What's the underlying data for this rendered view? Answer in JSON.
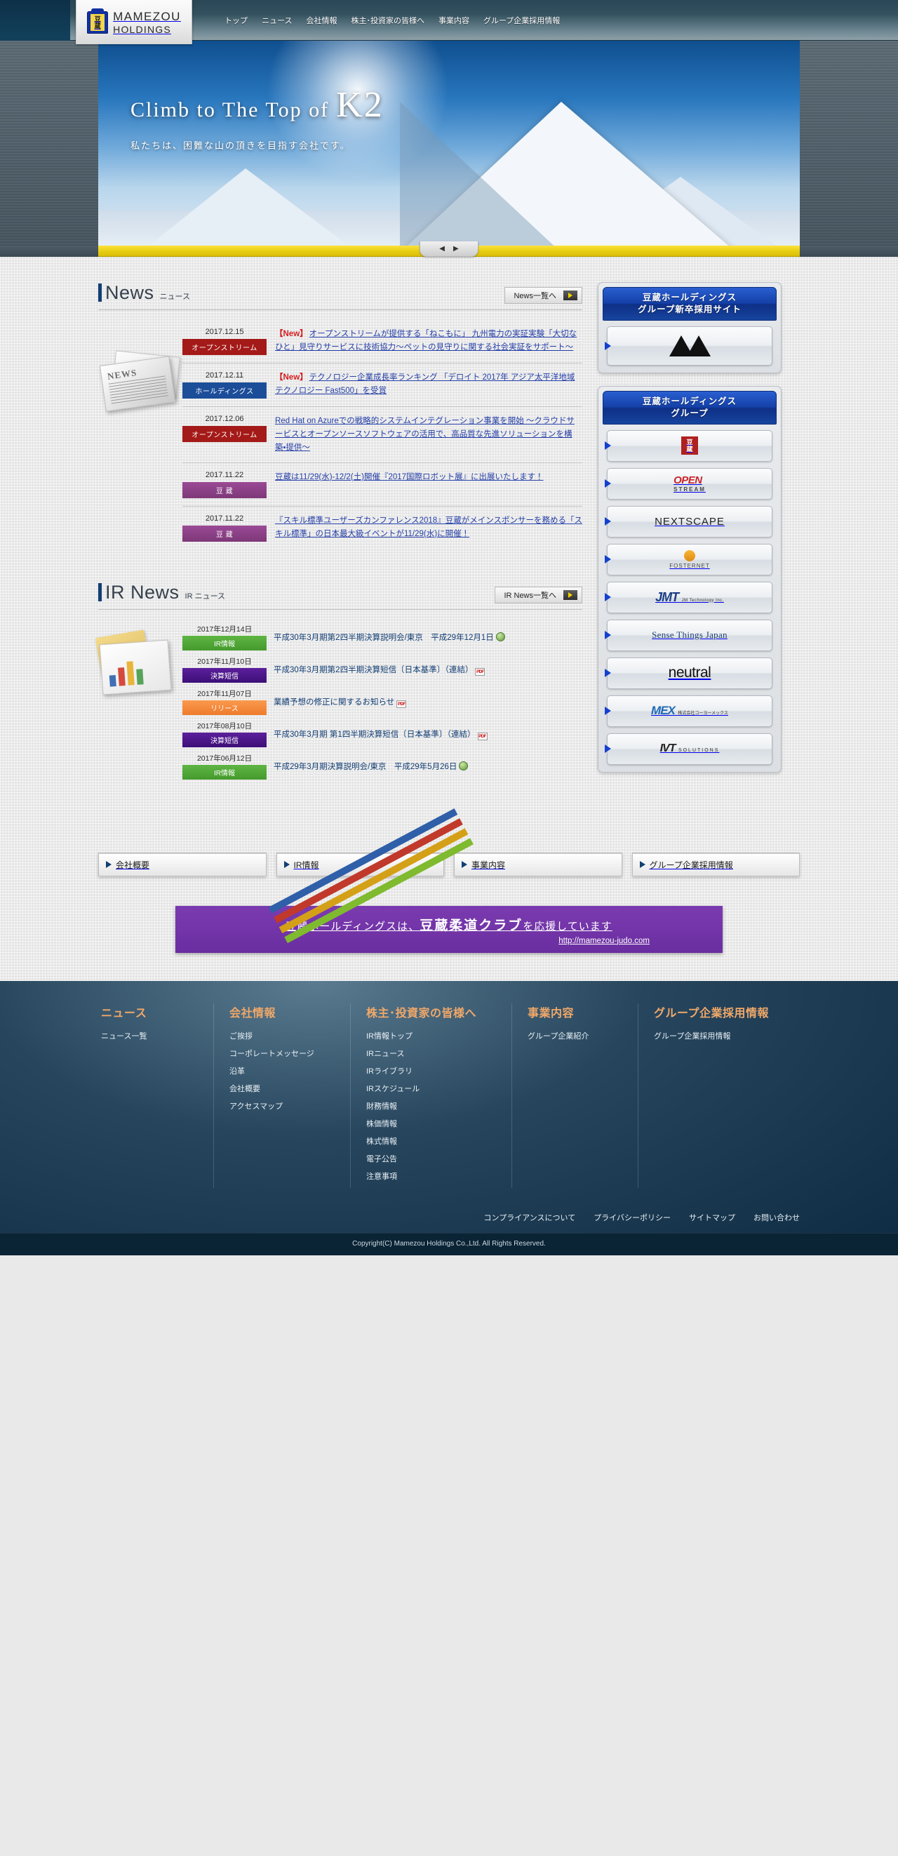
{
  "site": {
    "logo_main": "MAMEZOU",
    "logo_sub": "HOLDINGS",
    "logo_kanji_top": "豆",
    "logo_kanji_bottom": "蔵"
  },
  "nav": [
    {
      "label": "トップ"
    },
    {
      "label": "ニュース"
    },
    {
      "label": "会社情報"
    },
    {
      "label": "株主･投資家の皆様へ"
    },
    {
      "label": "事業内容"
    },
    {
      "label": "グループ企業採用情報"
    }
  ],
  "hero": {
    "headline_prefix": "Climb to The Top of",
    "headline_peak": "K2",
    "subline": "私たちは、困難な山の頂きを目指す会社です。",
    "prev_glyph": "◀",
    "next_glyph": "▶"
  },
  "news": {
    "title_en": "News",
    "title_jp": "ニュース",
    "more_label": "News一覧へ",
    "items": [
      {
        "date": "2017.12.15",
        "category": "オープンストリーム",
        "category_color": "#a41a18",
        "is_new": true,
        "new_label": "【New】",
        "text": "オープンストリームが提供する「ねこもに」 九州電力の実証実験「大切なひと」見守りサービスに技術協力～ペットの見守りに関する社会実証をサポート～"
      },
      {
        "date": "2017.12.11",
        "category": "ホールディングス",
        "category_color": "#1b4d99",
        "is_new": true,
        "new_label": "【New】",
        "text": "テクノロジー企業成長率ランキング 「デロイト 2017年 アジア太平洋地域テクノロジー Fast500」を受賞"
      },
      {
        "date": "2017.12.06",
        "category": "オープンストリーム",
        "category_color": "#a41a18",
        "is_new": false,
        "new_label": "",
        "text": "Red Hat on Azureでの戦略的システムインテグレーション事業を開始 ～クラウドサービスとオープンソースソフトウェアの活用で、高品質な先進ソリューションを構築・提供～"
      },
      {
        "date": "2017.11.22",
        "category": "豆 蔵",
        "category_color": "#8a3f85",
        "is_new": false,
        "new_label": "",
        "text": "豆蔵は11/29(水)-12/2(土)開催『2017国際ロボット展』に出展いたします！"
      },
      {
        "date": "2017.11.22",
        "category": "豆 蔵",
        "category_color": "#8a3f85",
        "is_new": false,
        "new_label": "",
        "text": "『スキル標準ユーザーズカンファレンス2018』豆蔵がメインスポンサーを務める「スキル標準」の日本最大級イベントが11/29(水)に開催！"
      }
    ]
  },
  "ir_news": {
    "title_en": "IR News",
    "title_jp": "IR ニュース",
    "more_label": "IR News一覧へ",
    "items": [
      {
        "date": "2017年12月14日",
        "category": "IR情報",
        "badge": "green",
        "text": "平成30年3月期第2四半期決算説明会/東京　平成29年12月1日",
        "icon": "web"
      },
      {
        "date": "2017年11月10日",
        "category": "決算短信",
        "badge": "purple",
        "text": "平成30年3月期第2四半期決算短信〔日本基準〕（連結）",
        "icon": "pdf"
      },
      {
        "date": "2017年11月07日",
        "category": "リリース",
        "badge": "orange",
        "text": "業績予想の修正に関するお知らせ",
        "icon": "pdf"
      },
      {
        "date": "2017年08月10日",
        "category": "決算短信",
        "badge": "purple",
        "text": "平成30年3月期 第1四半期決算短信〔日本基準〕（連結）",
        "icon": "pdf"
      },
      {
        "date": "2017年06月12日",
        "category": "IR情報",
        "badge": "green",
        "text": "平成29年3月期決算説明会/東京　平成29年5月26日",
        "icon": "web"
      }
    ]
  },
  "sidebar": {
    "recruit_panel": {
      "title_line1": "豆蔵ホールディングス",
      "title_line2": "グループ新卒採用サイト",
      "logo_name": "twin-mountain-logo"
    },
    "group_panel": {
      "title_line1": "豆蔵ホールディングス",
      "title_line2": "グループ",
      "companies": [
        {
          "name": "豆蔵",
          "kanji_top": "豆",
          "kanji_bottom": "蔵",
          "style": "mamezou"
        },
        {
          "name": "OPEN STREAM",
          "main": "OPEN",
          "sub": "STREAM",
          "style": "openstream"
        },
        {
          "name": "NEXTSCAPE",
          "main": "NEXTSCAPE",
          "style": "nextscape"
        },
        {
          "name": "FOSTER NET",
          "main": "FOSTERNET",
          "style": "foster"
        },
        {
          "name": "JMT",
          "main": "JMT",
          "sub": "JM Technology Inc.",
          "style": "jmt"
        },
        {
          "name": "Sense Things Japan",
          "main": "Sense Things Japan",
          "style": "sense"
        },
        {
          "name": "neutral",
          "main": "neutral",
          "style": "neutral"
        },
        {
          "name": "MEX",
          "main": "MEX",
          "sub": "株式会社コーヨーメックス",
          "style": "mex"
        },
        {
          "name": "IVT SOLUTIONS",
          "main": "IVT",
          "sub": "SOLUTIONS",
          "style": "ivt"
        }
      ]
    }
  },
  "cards": [
    {
      "label": "会社概要",
      "image": "office-building-people"
    },
    {
      "label": "IR情報",
      "image": "colored-arrows-chart"
    },
    {
      "label": "事業内容",
      "image": "blue-globe-network"
    },
    {
      "label": "グループ企業採用情報",
      "image": "businesswoman-portrait"
    }
  ],
  "judo_banner": {
    "text_before": "豆蔵ホールディングスは、",
    "text_highlight": "豆蔵柔道クラブ",
    "text_after": "を応援しています",
    "url": "http://mamezou-judo.com",
    "bg_color": "#7b3bb0"
  },
  "footer": {
    "columns": [
      {
        "heading": "ニュース",
        "links": [
          "ニュース一覧"
        ]
      },
      {
        "heading": "会社情報",
        "links": [
          "ご挨拶",
          "コーポレートメッセージ",
          "沿革",
          "会社概要",
          "アクセスマップ"
        ]
      },
      {
        "heading": "株主･投資家の皆様へ",
        "links": [
          "IR情報トップ",
          "IRニュース",
          "IRライブラリ",
          "IRスケジュール",
          "財務情報",
          "株価情報",
          "株式情報",
          "電子公告",
          "注意事項"
        ]
      },
      {
        "heading": "事業内容",
        "links": [
          "グループ企業紹介"
        ]
      },
      {
        "heading": "グループ企業採用情報",
        "links": [
          "グループ企業採用情報"
        ]
      }
    ],
    "utility_links": [
      "コンプライアンスについて",
      "プライバシーポリシー",
      "サイトマップ",
      "お問い合わせ"
    ],
    "copyright": "Copyright(C) Mamezou  Holdings Co.,Ltd. All Rights Reserved."
  }
}
